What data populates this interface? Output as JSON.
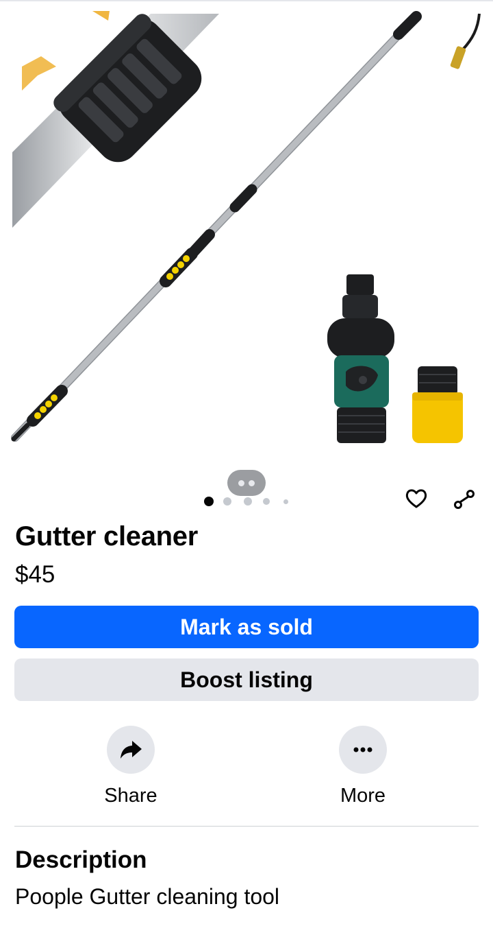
{
  "listing": {
    "title": "Gutter cleaner",
    "price": "$45",
    "image_count": 5,
    "active_image": 1
  },
  "actions": {
    "mark_sold_label": "Mark as sold",
    "boost_label": "Boost listing",
    "share_label": "Share",
    "more_label": "More"
  },
  "description": {
    "heading": "Description",
    "text": "Poople Gutter cleaning tool"
  },
  "icons": {
    "save": "heart-outline-icon",
    "share_link": "share-nodes-icon",
    "share": "share-arrow-icon",
    "more": "ellipsis-icon",
    "image_toggle": "image-toggle-icon"
  },
  "colors": {
    "primary": "#0866ff",
    "secondary_bg": "#e4e6eb",
    "text": "#050505"
  }
}
